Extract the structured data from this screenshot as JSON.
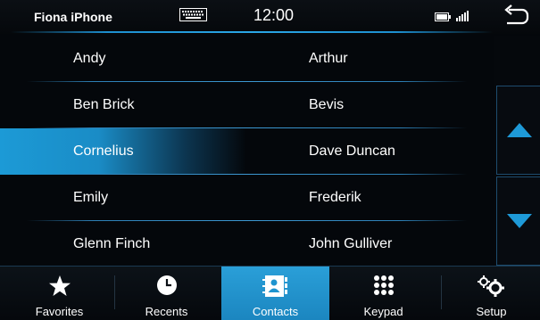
{
  "status": {
    "device_name": "Fiona iPhone",
    "time": "12:00",
    "icons": [
      "keyboard-icon",
      "battery-icon",
      "signal-icon",
      "back-arrow-icon"
    ]
  },
  "contacts": {
    "rows": [
      {
        "left": "Andy",
        "right": "Arthur"
      },
      {
        "left": "Ben Brick",
        "right": "Bevis"
      },
      {
        "left": "Cornelius",
        "right": "Dave Duncan"
      },
      {
        "left": "Emily",
        "right": "Frederik"
      },
      {
        "left": "Glenn Finch",
        "right": "John Gulliver"
      }
    ],
    "selected": "Cornelius"
  },
  "scroll": {
    "up_icon": "triangle-up-icon",
    "down_icon": "triangle-down-icon"
  },
  "nav": {
    "items": [
      {
        "label": "Favorites",
        "icon": "star-icon"
      },
      {
        "label": "Recents",
        "icon": "clock-icon"
      },
      {
        "label": "Contacts",
        "icon": "contacts-book-icon"
      },
      {
        "label": "Keypad",
        "icon": "keypad-icon"
      },
      {
        "label": "Setup",
        "icon": "gears-icon"
      }
    ],
    "active": "Contacts"
  },
  "colors": {
    "accent": "#1c9ad6",
    "background": "#04070b",
    "separator": "#2d7fb5"
  }
}
